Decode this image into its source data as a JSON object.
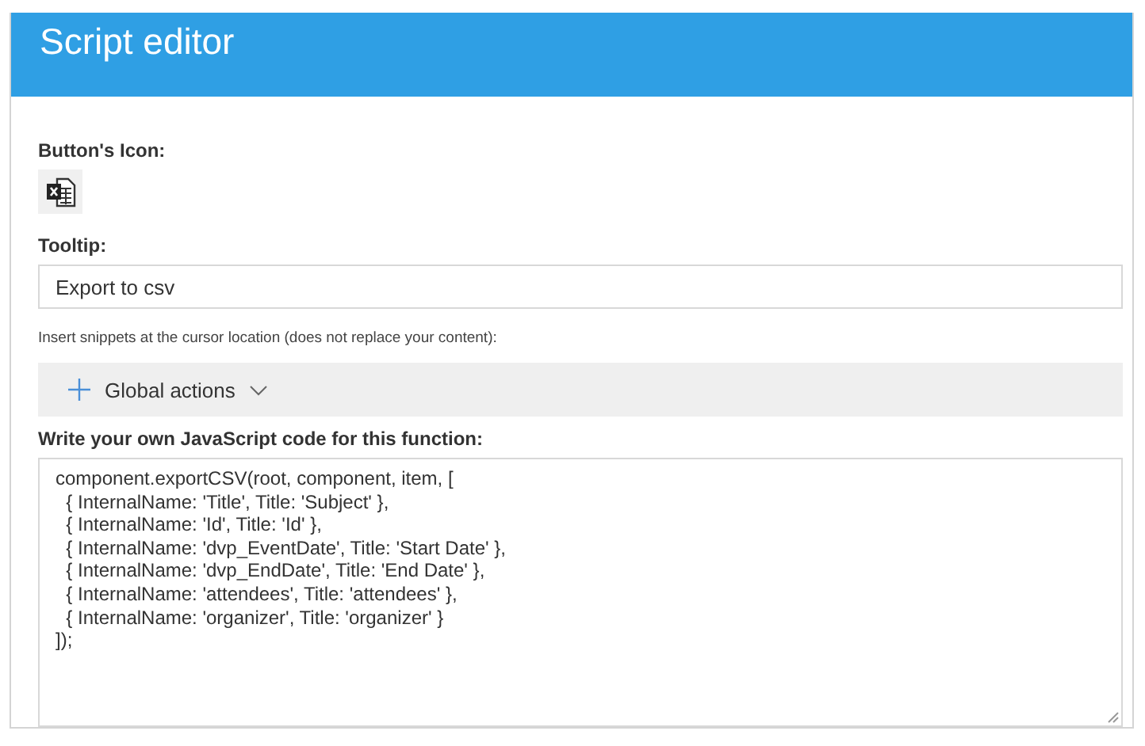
{
  "header": {
    "title": "Script editor"
  },
  "icon_field": {
    "label": "Button's Icon:"
  },
  "tooltip": {
    "label": "Tooltip:",
    "value": "Export to csv"
  },
  "snippets": {
    "hint": "Insert snippets at the cursor location (does not replace your content):",
    "menu": {
      "label": "Global actions",
      "expanded": false
    }
  },
  "code": {
    "label": "Write your own JavaScript code for this function:",
    "lines": [
      "component.exportCSV(root, component, item, [",
      "  { InternalName: 'Title', Title: 'Subject' },",
      "  { InternalName: 'Id', Title: 'Id' },",
      "  { InternalName: 'dvp_EventDate', Title: 'Start Date' },",
      "  { InternalName: 'dvp_EndDate', Title: 'End Date' },",
      "  { InternalName: 'attendees', Title: 'attendees' },",
      "  { InternalName: 'organizer', Title: 'organizer' }",
      "]);"
    ]
  }
}
